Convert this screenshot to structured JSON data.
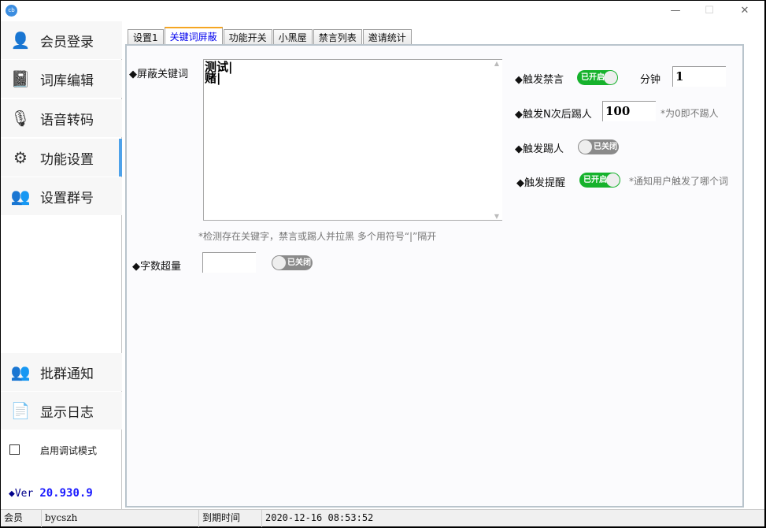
{
  "window": {
    "minimize": "—",
    "maximize": "☐",
    "close": "✕",
    "icon": "app-logo"
  },
  "sidebar": {
    "items": [
      {
        "label": "会员登录",
        "icon": "user-icon",
        "glyph": "👤"
      },
      {
        "label": "词库编辑",
        "icon": "book-icon",
        "glyph": "📓"
      },
      {
        "label": "语音转码",
        "icon": "microphone-icon",
        "glyph": "🎙"
      },
      {
        "label": "功能设置",
        "icon": "gear-icon",
        "glyph": "⚙"
      },
      {
        "label": "设置群号",
        "icon": "group-icon",
        "glyph": "👥"
      },
      {
        "label": "批群通知",
        "icon": "users-icon",
        "glyph": "👥"
      },
      {
        "label": "显示日志",
        "icon": "log-icon",
        "glyph": "📄"
      }
    ],
    "active": "功能设置",
    "accent": "#4ea2ea",
    "debug_label": "启用调试模式",
    "debug_checked": false,
    "ver_label": "◆Ver",
    "ver_value": "20.930.9"
  },
  "tabs": [
    "设置1",
    "关键词屏蔽",
    "功能开关",
    "小黑屋",
    "禁言列表",
    "邀请统计"
  ],
  "selected_tab": "关键词屏蔽",
  "panel": {
    "keywords_label": "◆屏蔽关键词",
    "keywords_value": "测试|\n赌|",
    "keywords_hint": "*检测存在关键字，禁言或踢人并拉黑 多个用符号“|”隔开",
    "wordcount_label": "◆字数超量",
    "wordcount_value": "",
    "wordcount_switch": "已关闭",
    "mute_label": "◆触发禁言",
    "mute_switch": "已开启",
    "minutes_label": "分钟",
    "minutes_value": "1",
    "kickn_label": "◆触发N次后踢人",
    "kickn_value": "100",
    "kickn_hint": "*为0即不踢人",
    "kick_label": "◆触发踢人",
    "kick_switch": "已关闭",
    "remind_label": "◆触发提醒",
    "remind_switch": "已开启",
    "remind_hint": "*通知用户触发了哪个词",
    "on_color": "#16b22c",
    "off_color": "#8a8a8a"
  },
  "status": {
    "member_label": "会员",
    "member_value": "bycszh",
    "expire_label": "到期时间",
    "expire_value": "2020-12-16 08:53:52"
  }
}
